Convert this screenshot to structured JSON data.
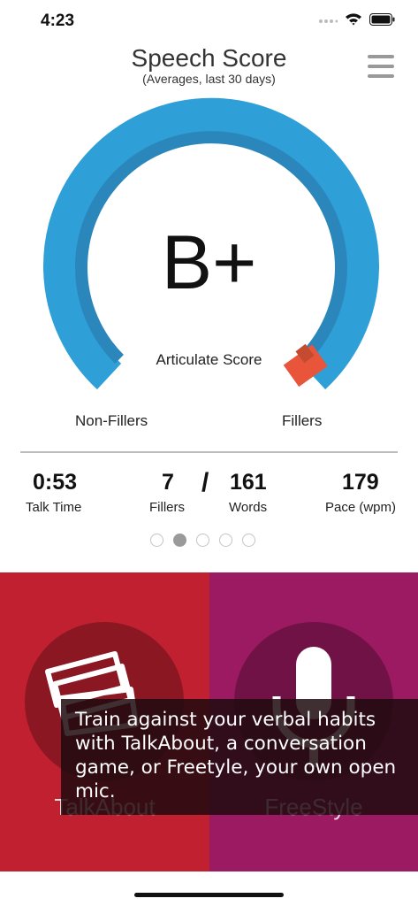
{
  "status_bar": {
    "time": "4:23"
  },
  "header": {
    "title": "Speech Score",
    "subtitle": "(Averages, last 30 days)"
  },
  "gauge": {
    "grade": "B+",
    "label": "Articulate Score",
    "left_label": "Non-Fillers",
    "right_label": "Fillers",
    "colors": {
      "track": "#2f9fd8",
      "track_inner": "#2b87bb",
      "fillers": "#e8553a",
      "fillers_inner": "#c44a30"
    }
  },
  "stats": {
    "talk_time": {
      "value": "0:53",
      "label": "Talk Time"
    },
    "fillers": {
      "value": "7",
      "label": "Fillers"
    },
    "separator": "/",
    "words": {
      "value": "161",
      "label": "Words"
    },
    "pace": {
      "value": "179",
      "label": "Pace (wpm)"
    }
  },
  "pager": {
    "count": 5,
    "active_index": 1
  },
  "panels": {
    "talkabout": {
      "label": "TalkAbout",
      "icon": "cards-icon",
      "color": "#c0202f"
    },
    "freestyle": {
      "label": "FreeStyle",
      "icon": "microphone-icon",
      "color": "#9b1a62"
    }
  },
  "tooltip": {
    "text": "Train against your verbal habits with TalkAbout, a conversation game, or Freetyle, your own open mic."
  }
}
